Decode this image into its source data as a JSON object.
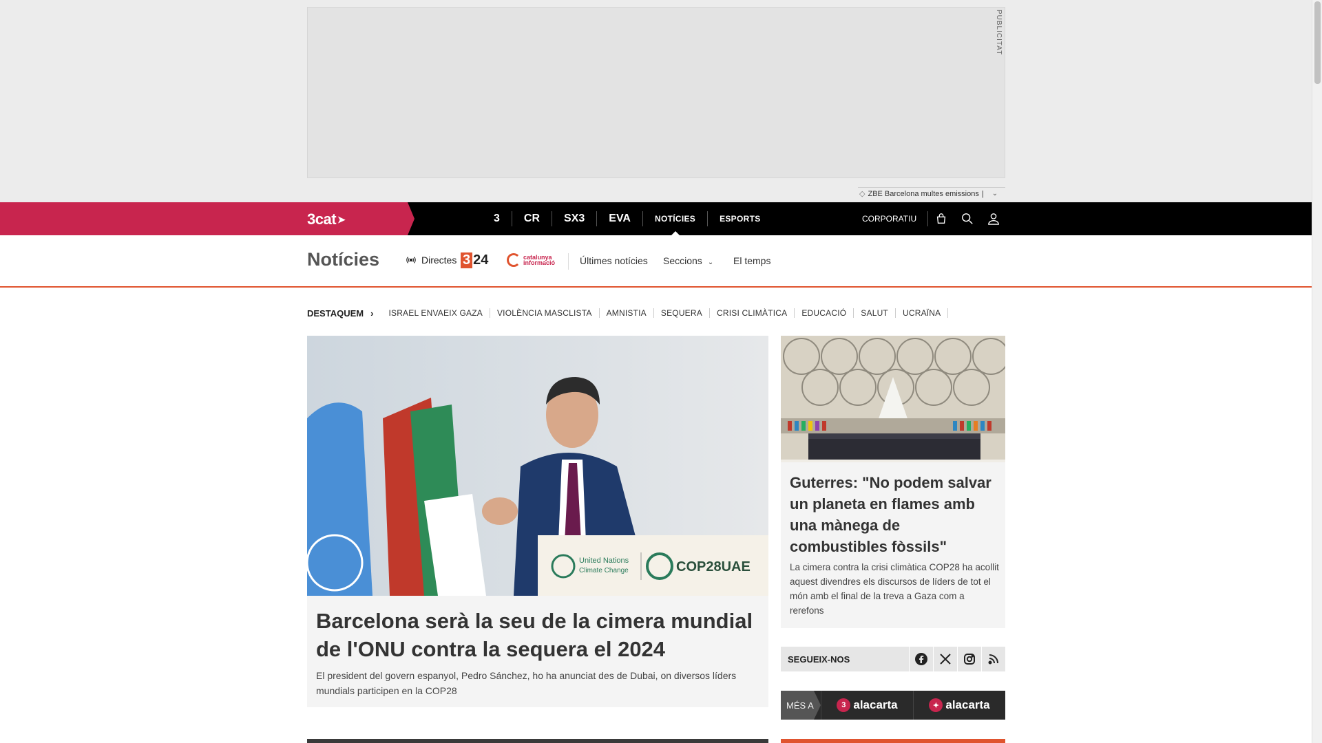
{
  "ad": {
    "label": "PUBLICITAT",
    "info_text": "ZBE Barcelona multes emissions",
    "info_sep": "|"
  },
  "topnav": {
    "brand": "3cat",
    "channels": [
      {
        "label": "3",
        "icon": "tv3-logo"
      },
      {
        "label": "CR",
        "icon": "catradio-logo"
      },
      {
        "label": "SX3",
        "icon": "sx3-logo"
      },
      {
        "label": "EVA",
        "icon": "eva-logo"
      }
    ],
    "links": [
      "NOTÍCIES",
      "ESPORTS"
    ],
    "active": "NOTÍCIES",
    "corporatiu": "CORPORATIU"
  },
  "section": {
    "title": "Notícies",
    "directes": "Directes",
    "logo_324": "3/24",
    "logo_ci": "catalunya informació",
    "links": [
      "Últimes notícies",
      "Seccions",
      "El temps"
    ]
  },
  "destaquem": {
    "label": "DESTAQUEM",
    "items": [
      "ISRAEL ENVAEIX GAZA",
      "VIOLÈNCIA MASCLISTA",
      "AMNISTIA",
      "SEQUERA",
      "CRISI CLIMÀTICA",
      "EDUCACIÓ",
      "SALUT",
      "UCRAÏNA"
    ]
  },
  "main_story": {
    "headline": "Barcelona serà la seu de la cimera mundial de l'ONU contra la sequera el 2024",
    "lead": "El president del govern espanyol, Pedro Sánchez, ho ha anunciat des de Dubai, on diversos líders mundials participen en la COP28",
    "podium_un": "United Nations",
    "podium_un2": "Climate Change",
    "podium_cop": "COP28UAE"
  },
  "side_story": {
    "headline": "Guterres: \"No podem salvar un planeta en flames amb una mànega de combustibles fòssils\"",
    "lead": "La cimera contra la crisi climàtica COP28 ha acollit aquest divendres els discursos de líders de tot el món amb el final de la treva a Gaza com a rerefons"
  },
  "follow": {
    "label": "SEGUEIX-NOS",
    "icons": [
      "facebook-icon",
      "x-icon",
      "instagram-icon",
      "rss-icon"
    ]
  },
  "mesa": {
    "label": "MÉS A",
    "buttons": [
      {
        "badge": "3",
        "text": "alacarta"
      },
      {
        "badge": "✦",
        "text": "alacarta"
      }
    ]
  }
}
